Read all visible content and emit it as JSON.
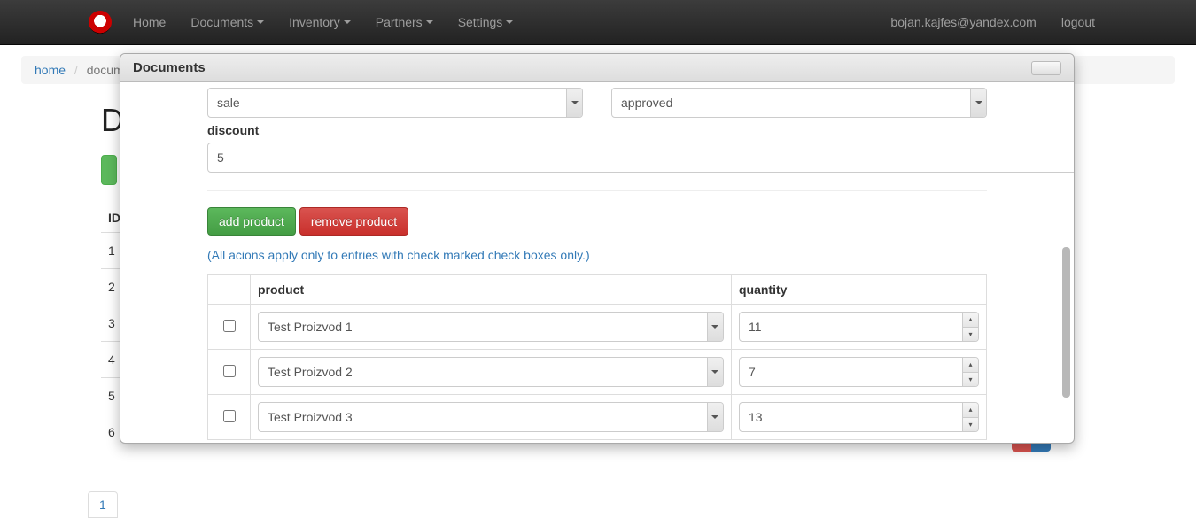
{
  "nav": {
    "home": "Home",
    "documents": "Documents",
    "inventory": "Inventory",
    "partners": "Partners",
    "settings": "Settings",
    "user": "bojan.kajfes@yandex.com",
    "logout": "logout"
  },
  "breadcrumb": {
    "home": "home",
    "current": "docume"
  },
  "page": {
    "title_fragment": "D",
    "rows": [
      "ID",
      "1",
      "2",
      "3",
      "4",
      "5",
      "6"
    ],
    "pager": "1"
  },
  "modal": {
    "title": "Documents",
    "type_value": "sale",
    "status_value": "approved",
    "discount_label": "discount",
    "discount_value": "5",
    "add_product": "add product",
    "remove_product": "remove product",
    "helper": "(All acions apply only to entries with check marked check boxes only.)",
    "columns": {
      "product": "product",
      "quantity": "quantity"
    },
    "rows": [
      {
        "product": "Test Proizvod 1",
        "quantity": "11"
      },
      {
        "product": "Test Proizvod 2",
        "quantity": "7"
      },
      {
        "product": "Test Proizvod 3",
        "quantity": "13"
      }
    ]
  }
}
